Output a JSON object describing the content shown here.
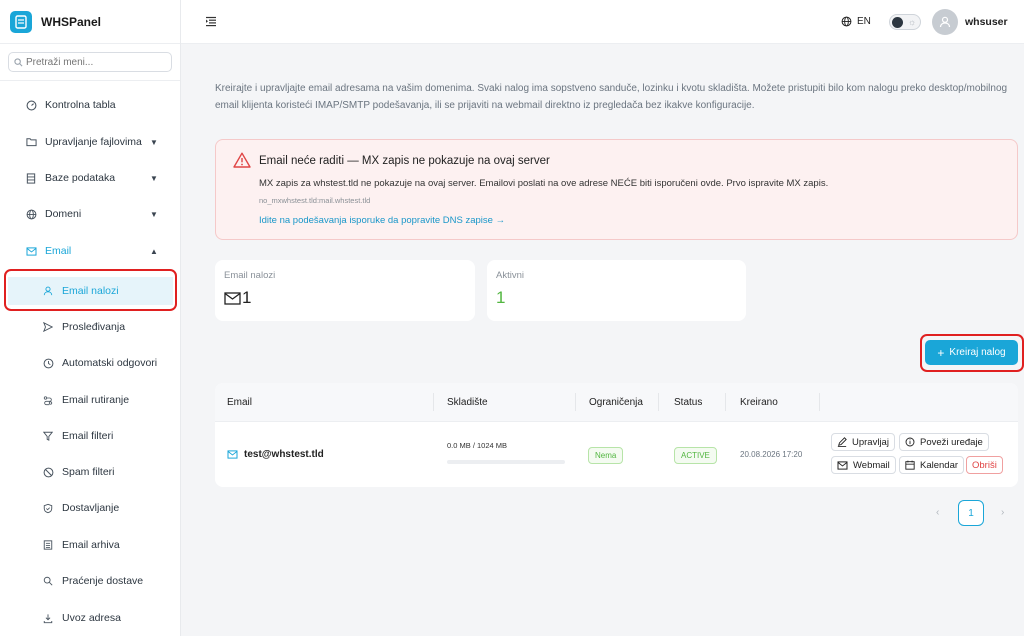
{
  "app": {
    "name": "WHSPanel"
  },
  "search": {
    "placeholder": "Pretraži meni..."
  },
  "sidebar": {
    "items": [
      {
        "label": "Kontrolna tabla",
        "icon": "dashboard-icon"
      },
      {
        "label": "Upravljanje fajlovima",
        "icon": "folder-icon"
      },
      {
        "label": "Baze podataka",
        "icon": "database-icon"
      },
      {
        "label": "Domeni",
        "icon": "globe-icon"
      },
      {
        "label": "Email",
        "icon": "mail-icon"
      }
    ],
    "email_sub": [
      {
        "label": "Email nalozi",
        "icon": "user-icon"
      },
      {
        "label": "Prosleđivanja",
        "icon": "send-icon"
      },
      {
        "label": "Automatski odgovori",
        "icon": "clock-icon"
      },
      {
        "label": "Email rutiranje",
        "icon": "route-icon"
      },
      {
        "label": "Email filteri",
        "icon": "filter-icon"
      },
      {
        "label": "Spam filteri",
        "icon": "ban-icon"
      },
      {
        "label": "Dostavljanje",
        "icon": "shield-check-icon"
      },
      {
        "label": "Email arhiva",
        "icon": "archive-icon"
      },
      {
        "label": "Praćenje dostave",
        "icon": "search-icon"
      },
      {
        "label": "Uvoz adresa",
        "icon": "import-icon"
      }
    ]
  },
  "topbar": {
    "lang": "EN",
    "username": "whsuser"
  },
  "intro": "Kreirajte i upravljajte email adresama na vašim domenima. Svaki nalog ima sopstveno sanduče, lozinku i kvotu skladišta. Možete pristupiti bilo kom nalogu preko desktop/mobilnog email klijenta koristeći IMAP/SMTP podešavanja, ili se prijaviti na webmail direktno iz pregledača bez ikakve konfiguracije.",
  "alert": {
    "title": "Email neće raditi — MX zapis ne pokazuje na ovaj server",
    "body": "MX zapis za whstest.tld ne pokazuje na ovaj server. Emailovi poslati na ove adrese NEĆE biti isporučeni ovde. Prvo ispravite MX zapis.",
    "small": "no_mxwhstest.tld:mail.whstest.tld",
    "link": "Idite na podešavanja isporuke da popravite DNS zapise →"
  },
  "stats": [
    {
      "label": "Email nalozi",
      "value": "1"
    },
    {
      "label": "Aktivni",
      "value": "1"
    }
  ],
  "create_button": "Kreiraj nalog",
  "table": {
    "headers": [
      "Email",
      "Skladište",
      "Ograničenja",
      "Status",
      "Kreirano"
    ],
    "rows": [
      {
        "email": "test@whstest.tld",
        "storage": "0.0 MB / 1024 MB",
        "storage_fraction": 0,
        "limits": "Nema",
        "status": "ACTIVE",
        "created": "20.08.2026 17:20"
      }
    ],
    "actions": {
      "manage": "Upravljaj",
      "connect": "Poveži uređaje",
      "webmail": "Webmail",
      "calendar": "Kalendar",
      "delete": "Obriši"
    }
  },
  "pagination": {
    "current": "1"
  },
  "colors": {
    "accent": "#1aa6d8",
    "danger": "#e04545",
    "success": "#52b640",
    "highlight": "#e02020"
  }
}
